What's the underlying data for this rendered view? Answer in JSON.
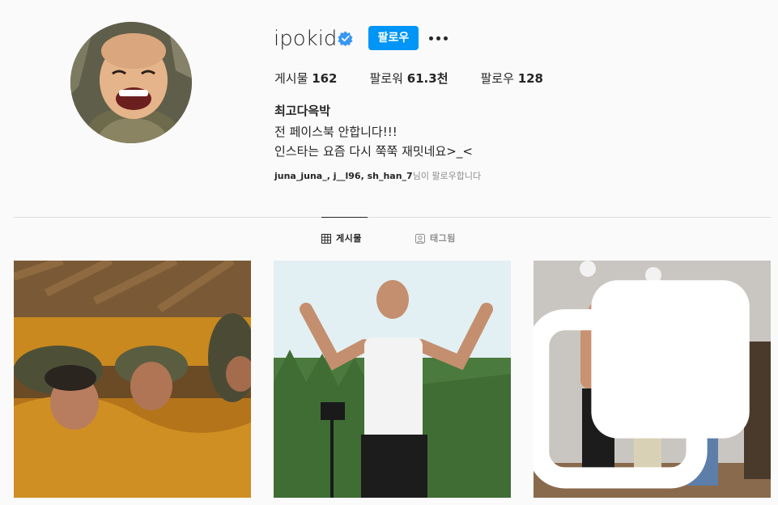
{
  "profile": {
    "username": "ipokid",
    "follow_label": "팔로우",
    "more_icon": "more-horizontal-icon",
    "verified_icon": "verified-badge-icon",
    "stats": [
      {
        "label": "게시물",
        "value": "162"
      },
      {
        "label": "팔로워",
        "value": "61.3천"
      },
      {
        "label": "팔로우",
        "value": "128"
      }
    ],
    "full_name": "최고다윽박",
    "bio": "전 페이스북 안합니다!!!\n인스타는 요즘 다시 쭉쭉 재밋네요>_<",
    "followed_by_names": "juna_juna_, j__l96, sh_han_7",
    "followed_by_suffix": "님이 팔로우합니다"
  },
  "tabs": [
    {
      "label": "게시물",
      "icon": "grid-icon",
      "active": true
    },
    {
      "label": "태그됨",
      "icon": "tag-person-icon",
      "active": false
    }
  ],
  "posts": [
    {
      "description": "post-1",
      "multi": false
    },
    {
      "description": "post-2",
      "multi": false
    },
    {
      "description": "post-3",
      "multi": true
    }
  ],
  "colors": {
    "accent": "#0095f6",
    "text": "#262626",
    "muted": "#8e8e8e",
    "divider": "#dbdbdb",
    "background": "#fafafa"
  }
}
